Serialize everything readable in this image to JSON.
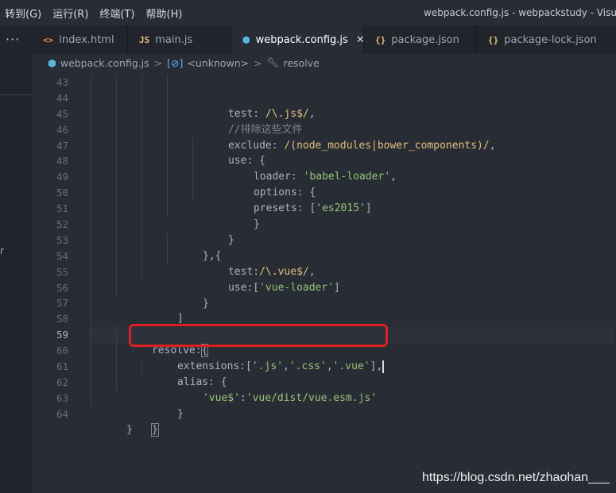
{
  "menubar": {
    "items": [
      "转到(G)",
      "运行(R)",
      "终端(T)",
      "帮助(H)"
    ],
    "window_title": "webpack.config.js - webpackstudy - Visual S"
  },
  "sidebar": {
    "overflow_label": "···",
    "edge_text": "r"
  },
  "tabs": [
    {
      "label": "index.html",
      "icon": "<>",
      "icon_name": "html-file-icon"
    },
    {
      "label": "main.js",
      "icon": "JS",
      "icon_name": "js-file-icon"
    },
    {
      "label": "webpack.config.js",
      "icon": "⬢",
      "icon_name": "webpack-file-icon",
      "active": true
    },
    {
      "label": "package.json",
      "icon": "{}",
      "icon_name": "json-file-icon"
    },
    {
      "label": "package-lock.json",
      "icon": "{}",
      "icon_name": "json-file-icon"
    }
  ],
  "tab_close": "✕",
  "breadcrumb": {
    "file": "webpack.config.js",
    "scope_icon": "[⊘]",
    "scope": "<unknown>",
    "symbol": "resolve",
    "sep": ">"
  },
  "editor": {
    "line_numbers": [
      "43",
      "44",
      "45",
      "46",
      "47",
      "48",
      "49",
      "50",
      "51",
      "52",
      "53",
      "54",
      "55",
      "56",
      "57",
      "58",
      "59",
      "60",
      "61",
      "62",
      "63",
      "64"
    ],
    "lines": {
      "l43a": "test: ",
      "l43b": "/\\.js$/",
      "l43c": ",",
      "l44": "//排除这些文件",
      "l45a": "exclude: ",
      "l45b": "/(node_modules|bower_components)/",
      "l45c": ",",
      "l46": "use: {",
      "l47a": "loader: ",
      "l47b": "'babel-loader'",
      "l47c": ",",
      "l48": "options: {",
      "l49a": "presets: [",
      "l49b": "'es2015'",
      "l49c": "]",
      "l50": "}",
      "l51": "}",
      "l52": "},{",
      "l53a": "test:",
      "l53b": "/\\.vue$/",
      "l53c": ",",
      "l54a": "use:[",
      "l54b": "'vue-loader'",
      "l54c": "]",
      "l55": "}",
      "l56": "]",
      "l57": "},",
      "l58a": "resolve:",
      "l58b": "{",
      "l59a": "extensions:[",
      "l59b": "'.js'",
      "l59c": ",",
      "l59d": "'.css'",
      "l59e": ",",
      "l59f": "'.vue'",
      "l59g": "],",
      "l60": "alias: {",
      "l61a": "'vue$'",
      "l61b": ":",
      "l61c": "'vue/dist/vue.esm.js'",
      "l62": "}",
      "l63": "}",
      "l64": "}"
    }
  },
  "watermark": "https://blog.csdn.net/zhaohan___",
  "colors": {
    "background": "#282c34",
    "string": "#98c379",
    "comment": "#7f848e",
    "regex": "#e5c07b",
    "highlight_box": "#e0201f"
  }
}
